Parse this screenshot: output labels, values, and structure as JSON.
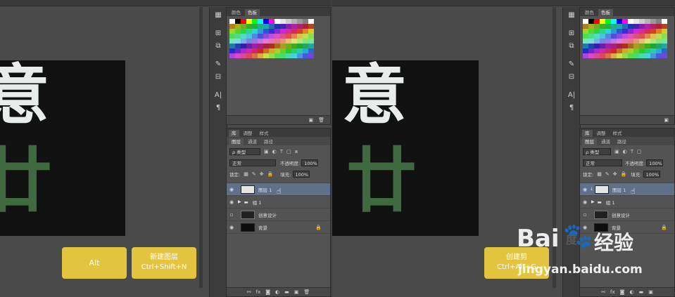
{
  "swatches_panel": {
    "tabs": [
      "颜色",
      "色板"
    ],
    "active_tab": "色板"
  },
  "layers_panel": {
    "top_tabs": [
      "库",
      "调整",
      "样式"
    ],
    "sub_tabs": [
      "图层",
      "通道",
      "路径"
    ],
    "filter_label": "ρ 类型",
    "blend_mode": "正常",
    "opacity_label": "不透明度:",
    "opacity_value": "100%",
    "lock_label": "锁定:",
    "fill_label": "填充:",
    "fill_value": "100%",
    "layers": [
      {
        "name": "图层 1",
        "selected": true,
        "visible": true
      },
      {
        "name": "组 1",
        "selected": false,
        "visible": true
      },
      {
        "name": "创意设计",
        "selected": false,
        "visible": false
      },
      {
        "name": "背景",
        "selected": false,
        "visible": true
      }
    ]
  },
  "canvas_text": {
    "char1": "意",
    "char2": "廿"
  },
  "left_overlay": {
    "key1": "Alt",
    "key2_line1": "新建图层",
    "key2_line2": "Ctrl+Shift+N"
  },
  "right_overlay": {
    "line1": "创建剪",
    "line2": "Ctrl+Alt+G"
  },
  "watermark": {
    "brand_latin": "Bai",
    "brand_cn": "度",
    "brand_extra": "经验",
    "url": "jingyan.baidu.com"
  },
  "colors": {
    "accent_yellow": "#e3c43f",
    "selected_layer": "#61708a",
    "glyph_white": "#e8ecea",
    "glyph_green": "#3f6a3f"
  }
}
